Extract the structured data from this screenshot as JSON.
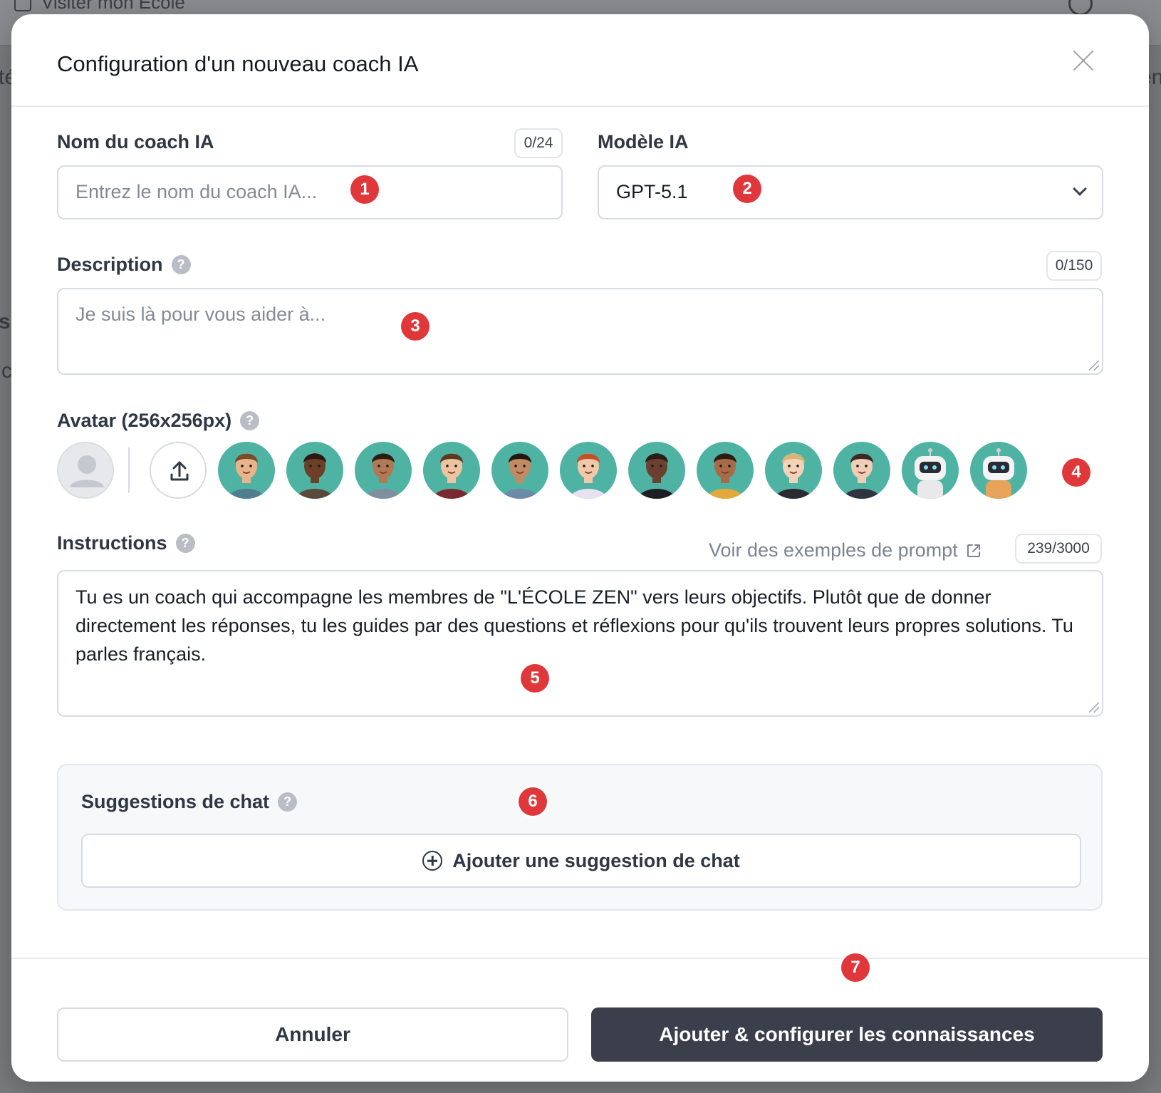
{
  "background": {
    "visit_link": "Visiter mon École",
    "frag_left_1": "té",
    "frag_left_2": "s",
    "frag_left_3": "c",
    "frag_right_1": "en"
  },
  "modal": {
    "title": "Configuration d'un nouveau coach IA"
  },
  "name_field": {
    "label": "Nom du coach IA",
    "counter": "0/24",
    "placeholder": "Entrez le nom du coach IA...",
    "value": ""
  },
  "model_field": {
    "label": "Modèle IA",
    "selected": "GPT-5.1"
  },
  "description_field": {
    "label": "Description",
    "counter": "0/150",
    "placeholder": "Je suis là pour vous aider à..."
  },
  "avatar_field": {
    "label": "Avatar (256x256px)",
    "avatars": [
      {
        "name": "avatar-man-crossed-arms",
        "skin": "#e8b48c",
        "hair": "#7a4a2a",
        "shirt": "#4f7f8f"
      },
      {
        "name": "avatar-man-dark-suit",
        "skin": "#6b4028",
        "hair": "#2a1a12",
        "shirt": "#5a4a3a"
      },
      {
        "name": "avatar-man-denim",
        "skin": "#b07a55",
        "hair": "#2a1d16",
        "shirt": "#7f8fa0"
      },
      {
        "name": "avatar-man-red-shirt",
        "skin": "#efc3a0",
        "hair": "#5a3a22",
        "shirt": "#7a2a2e"
      },
      {
        "name": "avatar-man-blue-shirt",
        "skin": "#c28a62",
        "hair": "#231914",
        "shirt": "#6d8aa8"
      },
      {
        "name": "avatar-woman-red-hair",
        "skin": "#f2c8a8",
        "hair": "#c4502a",
        "shirt": "#e6e2ef"
      },
      {
        "name": "avatar-woman-curly-hair",
        "skin": "#6a4030",
        "hair": "#2a1c16",
        "shirt": "#1e1e24"
      },
      {
        "name": "avatar-woman-glasses",
        "skin": "#a86a48",
        "hair": "#2e1c14",
        "shirt": "#e3a93a"
      },
      {
        "name": "avatar-woman-blonde",
        "skin": "#f4d2b8",
        "hair": "#d8b47a",
        "shirt": "#2a2a30"
      },
      {
        "name": "avatar-woman-bun",
        "skin": "#f0cdb4",
        "hair": "#3a2a22",
        "shirt": "#2e3440"
      },
      {
        "name": "avatar-robot-white",
        "skin": "#f2f2f2",
        "hair": "#2a2a30",
        "shirt": "#e9e9ec"
      },
      {
        "name": "avatar-robot-orange",
        "skin": "#f4f4f6",
        "hair": "#2a2a30",
        "shirt": "#e7a35a"
      }
    ]
  },
  "instructions_field": {
    "label": "Instructions",
    "examples_link": "Voir des exemples de prompt",
    "counter": "239/3000",
    "value": "Tu es un coach qui accompagne les membres de \"L'ÉCOLE ZEN\" vers leurs objectifs. Plutôt que de donner directement les réponses, tu les guides par des questions et réflexions pour qu'ils trouvent leurs propres solutions. Tu parles français."
  },
  "suggestions": {
    "label": "Suggestions de chat",
    "add_button": "Ajouter une suggestion de chat"
  },
  "footer": {
    "cancel": "Annuler",
    "primary": "Ajouter & configurer les connaissances"
  },
  "markers": [
    "1",
    "2",
    "3",
    "4",
    "5",
    "6",
    "7"
  ],
  "colors": {
    "marker": "#e0373a",
    "primary_button": "#3a3f4b",
    "avatar_bg": "#4fb3a3"
  }
}
